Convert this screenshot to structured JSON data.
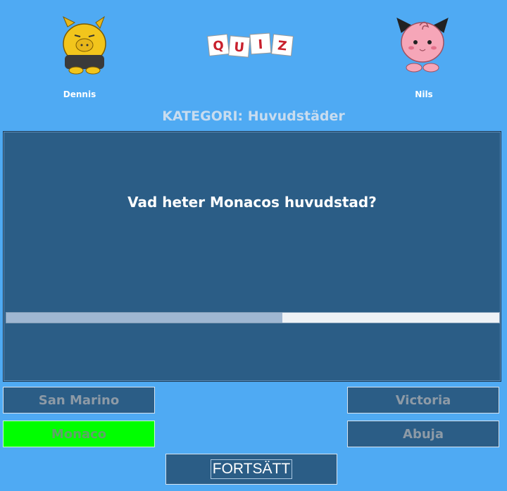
{
  "players": [
    {
      "name": "Dennis",
      "avatar_icon": "drowzee-icon"
    },
    {
      "name": "Nils",
      "avatar_icon": "clefairy-icon"
    }
  ],
  "logo": {
    "letters": [
      "Q",
      "U",
      "I",
      "Z"
    ],
    "icon": "quiz-logo-icon"
  },
  "category": {
    "text": "KATEGORI: Huvudstäder"
  },
  "question": {
    "text": "Vad heter Monacos huvudstad?"
  },
  "timer": {
    "progress_fraction": 0.56
  },
  "answers": [
    {
      "label": "San Marino",
      "state": "default"
    },
    {
      "label": "Victoria",
      "state": "default"
    },
    {
      "label": "Monaco",
      "state": "correct"
    },
    {
      "label": "Abuja",
      "state": "default"
    }
  ],
  "continue_button": {
    "label": "FORTSÄTT"
  },
  "colors": {
    "background": "#4faaf3",
    "panel": "#2b5d86",
    "correct": "#00ff00",
    "progress_fill": "#9fb7d2"
  }
}
